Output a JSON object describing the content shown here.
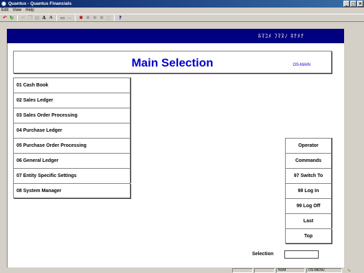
{
  "window": {
    "title": "Quantus - Quantus Financials",
    "controls": [
      "_",
      "□",
      "×"
    ]
  },
  "menubar": [
    "Edit",
    "View",
    "Help"
  ],
  "toolbar_icons": [
    "undo-icon",
    "refresh-icon",
    "cut-icon",
    "copy-icon",
    "paste-icon",
    "font-increase-icon",
    "font-decrease-icon",
    "window-icon",
    "minus-icon",
    "tool-a-icon",
    "tool-b-icon",
    "tool-c-icon",
    "tool-d-icon",
    "tool-e-icon",
    "help-icon"
  ],
  "bluebar_text": "ﾙﾏｺﾒ ﾌﾏﾇﾉ ﾈﾅﾒﾅ",
  "header": {
    "title": "Main Selection",
    "code": "OS-MAIN"
  },
  "menu_items": [
    "01 Cash Book",
    "02 Sales Ledger",
    "03 Sales Order Processing",
    "04 Purchase Ledger",
    "05 Purchase Order Processing",
    "06 General Ledger",
    "07 Entity Specific Settings",
    "08 System Manager"
  ],
  "commands": [
    "Operator",
    "Commands",
    "97 Switch To",
    "98 Log In",
    "99 Log Off",
    "Last",
    "Top"
  ],
  "selection": {
    "label": "Selection",
    "value": ""
  },
  "statusbar": {
    "num": "NUM",
    "menu": "OS-MENU"
  },
  "colors": {
    "title_gradient_start": "#0a246a",
    "bluebar": "#000080",
    "header_text": "#0000cc",
    "chrome": "#d4d0c8"
  }
}
